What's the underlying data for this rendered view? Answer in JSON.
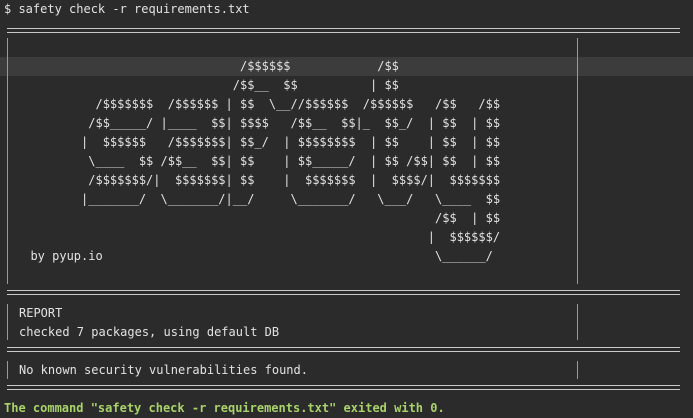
{
  "terminal": {
    "command": "$ safety check -r requirements.txt",
    "banner": [
      "                               /$$$$$$            /$$",
      "                              /$$__  $$          | $$",
      "           /$$$$$$$  /$$$$$$ | $$  \\__//$$$$$$  /$$$$$$   /$$   /$$",
      "          /$$_____/ |____  $$| $$$$   /$$__  $$|_  $$_/  | $$  | $$",
      "         |  $$$$$$   /$$$$$$$| $$_/  | $$$$$$$$  | $$    | $$  | $$",
      "          \\____  $$ /$$__  $$| $$    | $$_____/  | $$ /$$| $$  | $$",
      "          /$$$$$$$/|  $$$$$$$| $$    |  $$$$$$$  |  $$$$/|  $$$$$$$",
      "         |_______/  \\_______/|__/     \\_______/   \\___/   \\____  $$",
      "                                                          /$$  | $$",
      "                                                         |  $$$$$$/",
      "  by pyup.io                                              \\______/"
    ],
    "report": {
      "heading": "REPORT",
      "summary": "checked 7 packages, using default DB"
    },
    "result": "No known security vulnerabilities found.",
    "exit_message": "The command \"safety check -r requirements.txt\" exited with 0."
  }
}
